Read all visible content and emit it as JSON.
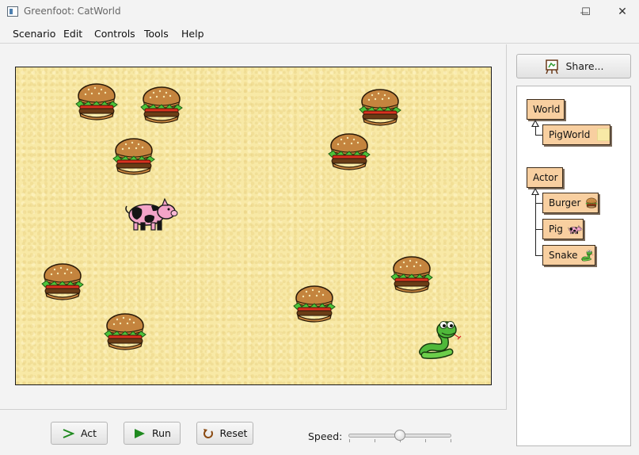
{
  "window": {
    "title": "Greenfoot: CatWorld",
    "minimize_glyph": "—",
    "maximize_glyph": "☐",
    "close_glyph": "✕"
  },
  "menu": [
    "Scenario",
    "Edit",
    "Controls",
    "Tools",
    "Help"
  ],
  "world": {
    "class_name": "PigWorld",
    "background_color": "#f8e9a6",
    "actors": [
      {
        "type": "burger"
      },
      {
        "type": "burger"
      },
      {
        "type": "burger"
      },
      {
        "type": "burger"
      },
      {
        "type": "burger"
      },
      {
        "type": "burger"
      },
      {
        "type": "burger"
      },
      {
        "type": "burger"
      },
      {
        "type": "burger"
      },
      {
        "type": "pig"
      },
      {
        "type": "snake"
      }
    ]
  },
  "controls": {
    "act_label": "Act",
    "run_label": "Run",
    "reset_label": "Reset",
    "speed_label": "Speed:",
    "speed_value": 0.5
  },
  "sidebar": {
    "share_label": "Share...",
    "class_tree": {
      "world_root": "World",
      "world_subclasses": [
        "PigWorld"
      ],
      "actor_root": "Actor",
      "actor_subclasses": [
        "Burger",
        "Pig",
        "Snake"
      ]
    }
  },
  "colors": {
    "class_box": "#f8cfa0",
    "run_arrow": "#1f8a1f",
    "sand": "#f8e9a6"
  }
}
